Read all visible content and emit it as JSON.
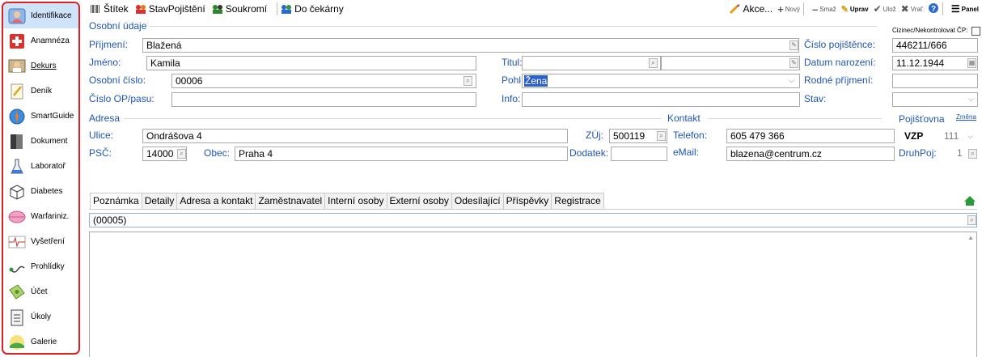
{
  "sidebar": {
    "items": [
      {
        "label": "Identifikace",
        "icon": "person-card-icon"
      },
      {
        "label": "Anamnéza",
        "icon": "red-cross-icon"
      },
      {
        "label": "Dekurs",
        "icon": "doctor-icon"
      },
      {
        "label": "Deník",
        "icon": "notepad-icon"
      },
      {
        "label": "SmartGuide",
        "icon": "compass-icon"
      },
      {
        "label": "Dokument",
        "icon": "binder-icon"
      },
      {
        "label": "Laboratoř",
        "icon": "flask-icon"
      },
      {
        "label": "Diabetes",
        "icon": "cube-icon"
      },
      {
        "label": "Warfariniz.",
        "icon": "pill-icon"
      },
      {
        "label": "Vyšetření",
        "icon": "ecg-icon"
      },
      {
        "label": "Prohlídky",
        "icon": "stethoscope-icon"
      },
      {
        "label": "Účet",
        "icon": "money-icon"
      },
      {
        "label": "Úkoly",
        "icon": "clipboard-icon"
      },
      {
        "label": "Galerie",
        "icon": "landscape-icon"
      }
    ]
  },
  "toolbar": {
    "stitek": "Štítek",
    "stav_pojisteni": "StavPojištění",
    "soukromi": "Soukromí",
    "do_cekarny": "Do čekárny",
    "akce": "Akce...",
    "novy": "Nový",
    "smaz": "Smaž",
    "uprav": "Uprav",
    "uloz": "Ulož",
    "vrat": "Vrať",
    "panel": "Panel"
  },
  "osobni": {
    "title": "Osobní údaje",
    "cizinec_label": "Cizinec/Nekontrolovat ČP:",
    "prijmeni_label": "Příjmení:",
    "prijmeni": "Blažená",
    "jmeno_label": "Jméno:",
    "jmeno": "Kamila",
    "titul_label": "Titul:",
    "titul_pred": "",
    "titul_za": "",
    "osobni_cislo_label": "Osobní číslo:",
    "osobni_cislo": "00006",
    "pohl_label": "Pohl.:",
    "pohl": "Žena",
    "cislo_op_label": "Číslo OP/pasu:",
    "cislo_op": "",
    "info_label": "Info:",
    "info": "",
    "cislo_pojistence_label": "Číslo pojištěnce:",
    "cislo_pojistence": "446211/666",
    "datum_narozeni_label": "Datum narození:",
    "datum_narozeni": "11.12.1944",
    "rodne_prijmeni_label": "Rodné příjmení:",
    "rodne_prijmeni": "",
    "stav_label": "Stav:",
    "stav": ""
  },
  "adresa": {
    "title": "Adresa",
    "ulice_label": "Ulice:",
    "ulice": "Ondrášova 4",
    "zuj_label": "ZÚj:",
    "zuj": "500119",
    "psc_label": "PSČ:",
    "psc": "14000",
    "obec_label": "Obec:",
    "obec": "Praha 4",
    "dodatek_label": "Dodatek:",
    "dodatek": ""
  },
  "kontakt": {
    "title": "Kontakt",
    "telefon_label": "Telefon:",
    "telefon": "605 479 366",
    "email_label": "eMail:",
    "email": "blazena@centrum.cz"
  },
  "pojistovna": {
    "title": "Pojišťovna",
    "zmena": "Změna",
    "name": "VZP",
    "code": "111",
    "druhpoj_label": "DruhPoj:",
    "druhpoj": "1"
  },
  "tabs": [
    "Poznámka",
    "Detaily",
    "Adresa a kontakt",
    "Zaměstnavatel",
    "Interní osoby",
    "Externí osoby",
    "Odesílající",
    "Příspěvky",
    "Registrace"
  ],
  "note": {
    "code": "(00005)",
    "text": ""
  }
}
